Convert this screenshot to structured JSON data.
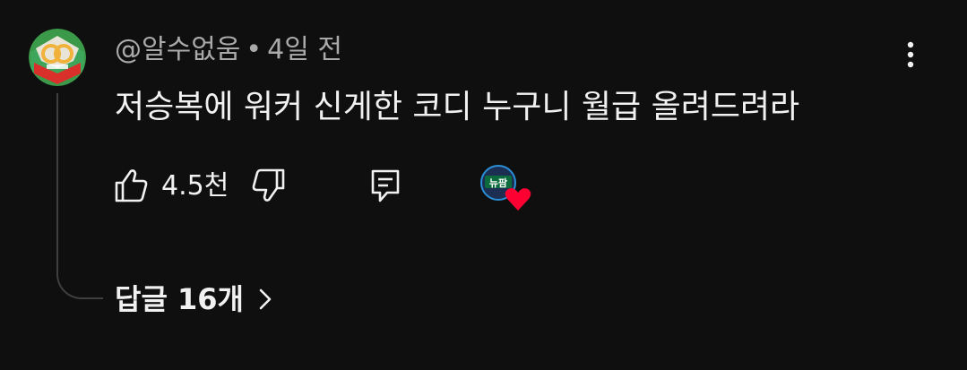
{
  "comment": {
    "author": "@알수없움",
    "separator": "•",
    "time": "4일 전",
    "text": "저승복에 워커 신게한 코디 누구니 월급 올려드려라",
    "like_count": "4.5천",
    "replies_label": "답글 16개"
  },
  "icons": {
    "avatar": "author-avatar",
    "more": "more-vert-icon",
    "like": "thumb-up-icon",
    "dislike": "thumb-down-icon",
    "reply": "reply-comment-icon",
    "creator_heart": "creator-heart-avatar",
    "replies_chevron": "chevron-right-icon"
  },
  "colors": {
    "background": "#0f0f0f",
    "primary_text": "#f1f1f1",
    "secondary_text": "#aaaaaa",
    "thread_line": "#3f3f3f",
    "heart": "#ff0033"
  }
}
